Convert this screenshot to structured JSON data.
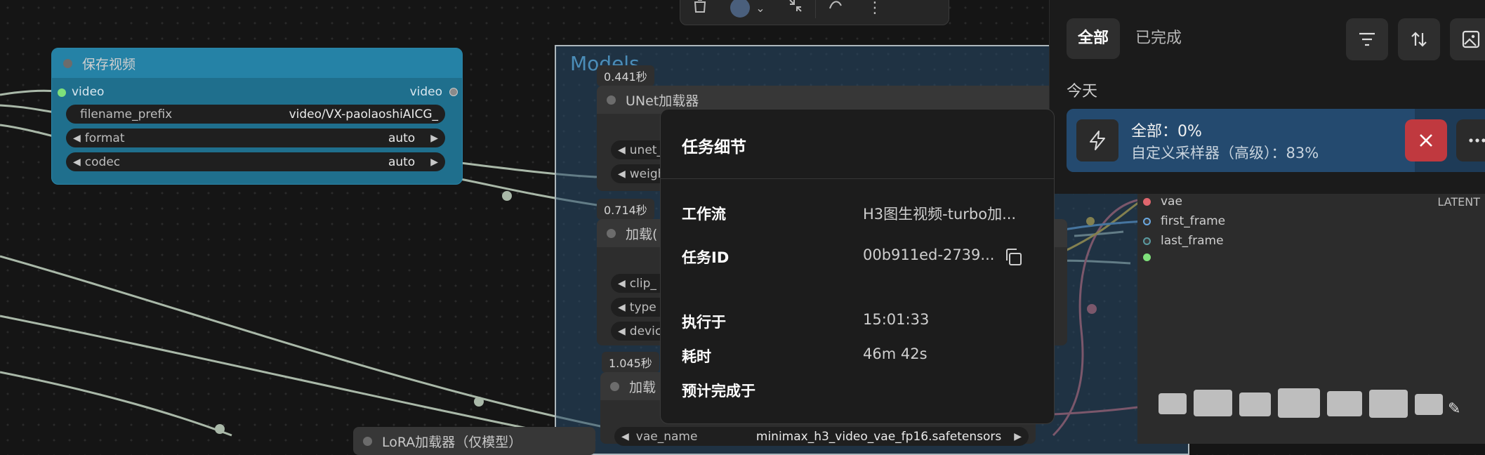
{
  "toolbar": {
    "more_label": "⋮"
  },
  "save_node": {
    "title": "保存视频",
    "input_label": "video",
    "output_label": "video",
    "widgets": [
      {
        "label": "filename_prefix",
        "value": "video/VX-paolaoshiAICG_"
      },
      {
        "label": "format",
        "value": "auto"
      },
      {
        "label": "codec",
        "value": "auto"
      }
    ]
  },
  "group": {
    "title": "Models"
  },
  "nodes": {
    "unet": {
      "time": "0.441秒",
      "title": "UNet加载器",
      "w1": "unet_",
      "w2": "weigh"
    },
    "clip": {
      "time": "0.714秒",
      "title": "加载(",
      "w1": "clip_",
      "w2": "type",
      "w3": "devic"
    },
    "vae": {
      "time": "1.045秒",
      "title": "加载",
      "widget_label": "vae_name",
      "widget_value": "minimax_h3_video_vae_fp16.safetensors"
    },
    "lora": {
      "title": "LoRA加载器（仅模型）"
    }
  },
  "right_node": {
    "ports": [
      "vae",
      "first_frame",
      "last_frame"
    ],
    "output_label": "LATENT"
  },
  "queue": {
    "tab_all": "全部",
    "tab_done": "已完成",
    "section_today": "今天",
    "task_line1": "全部：0%",
    "task_line2": "自定义采样器（高级）：83%",
    "task_progress_percent": 83
  },
  "popup": {
    "title": "任务细节",
    "rows": [
      {
        "label": "工作流",
        "value": "H3图生视频-turbo加..."
      },
      {
        "label": "任务ID",
        "value": "00b911ed-2739..."
      },
      {
        "label": "执行于",
        "value": "15:01:33"
      },
      {
        "label": "耗时",
        "value": "46m 42s"
      },
      {
        "label": "预计完成于",
        "value": ""
      }
    ]
  },
  "colors": {
    "save_node_body": "#1f6f8d",
    "save_node_header": "#2582a6",
    "group_border": "#aeb8bd",
    "task_card": "#1e3b57",
    "cancel": "#c0393f",
    "wire": "#a9b8a8",
    "wire_red": "#e0666d",
    "wire_yellow": "#f2c230",
    "wire_blue": "#6aa8e0"
  }
}
